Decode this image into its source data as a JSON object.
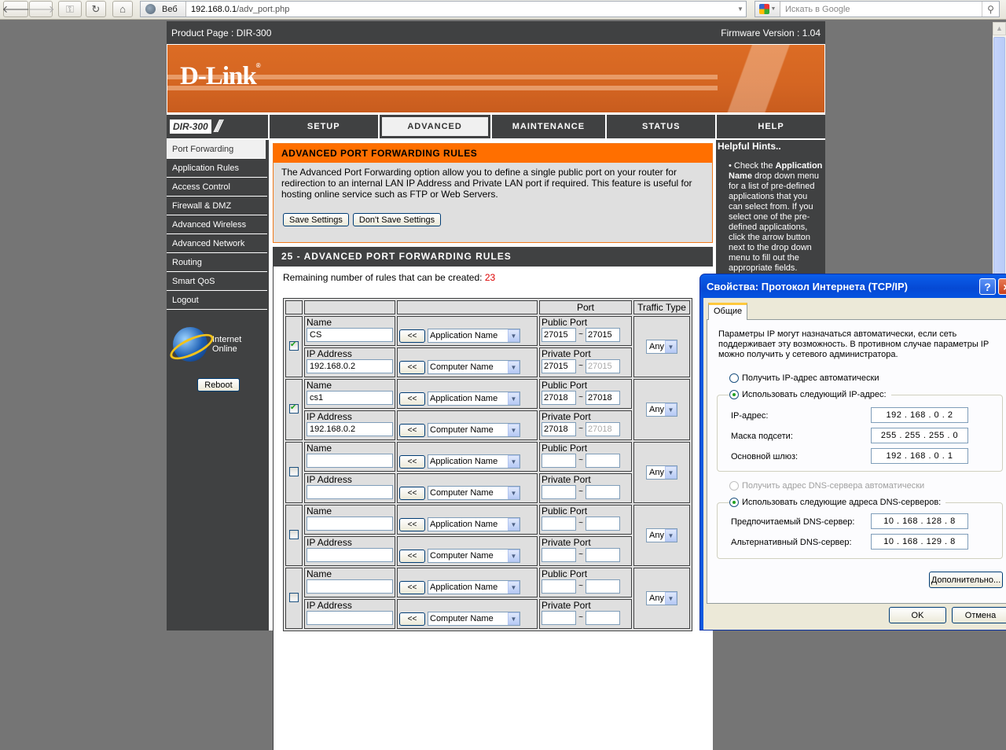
{
  "browser": {
    "url_host": "192.168.0.1",
    "url_path": "/adv_port.php",
    "web_chip": "Веб",
    "search_placeholder": "Искать в Google"
  },
  "router": {
    "product_page": "Product Page :  DIR-300",
    "firmware": "Firmware Version : 1.04",
    "logo": "D-Link",
    "model": "DIR-300",
    "tabs": [
      {
        "label": "SETUP",
        "active": false
      },
      {
        "label": "ADVANCED",
        "active": true
      },
      {
        "label": "MAINTENANCE",
        "active": false
      },
      {
        "label": "STATUS",
        "active": false
      },
      {
        "label": "HELP",
        "active": false
      }
    ],
    "sidebar": [
      {
        "label": "Port Forwarding",
        "active": true
      },
      {
        "label": "Application Rules"
      },
      {
        "label": "Access Control"
      },
      {
        "label": "Firewall & DMZ"
      },
      {
        "label": "Advanced Wireless"
      },
      {
        "label": "Advanced Network"
      },
      {
        "label": "Routing"
      },
      {
        "label": "Smart QoS"
      },
      {
        "label": "Logout"
      }
    ],
    "internet_status_line1": "Internet",
    "internet_status_line2": "Online",
    "reboot_label": "Reboot",
    "intro": {
      "title": "ADVANCED PORT FORWARDING RULES",
      "description": "The Advanced Port Forwarding option allow you to define a single public port on your router for redirection to an internal LAN IP Address and Private LAN port if required. This feature is useful for hosting online service such as FTP or Web Servers.",
      "save_label": "Save Settings",
      "dont_save_label": "Don't Save Settings"
    },
    "rules": {
      "title": "25 - ADVANCED PORT FORWARDING RULES",
      "remaining_label": "Remaining number of rules that can be created: ",
      "remaining_count": "23",
      "headers": {
        "port": "Port",
        "traffic": "Traffic Type"
      },
      "labels": {
        "name": "Name",
        "ip": "IP Address",
        "public_port": "Public Port",
        "private_port": "Private Port",
        "arrow": "<<",
        "app_select": "Application Name",
        "computer_select": "Computer Name",
        "tilde": "~"
      },
      "rows": [
        {
          "checked": true,
          "name": "CS",
          "ip": "192.168.0.2",
          "pub_start": "27015",
          "pub_end": "27015",
          "priv_start": "27015",
          "priv_end": "27015",
          "traffic": "Any"
        },
        {
          "checked": true,
          "name": "cs1",
          "ip": "192.168.0.2",
          "pub_start": "27018",
          "pub_end": "27018",
          "priv_start": "27018",
          "priv_end": "27018",
          "traffic": "Any"
        },
        {
          "checked": false,
          "name": "",
          "ip": "",
          "pub_start": "",
          "pub_end": "",
          "priv_start": "",
          "priv_end": "",
          "traffic": "Any"
        },
        {
          "checked": false,
          "name": "",
          "ip": "",
          "pub_start": "",
          "pub_end": "",
          "priv_start": "",
          "priv_end": "",
          "traffic": "Any"
        },
        {
          "checked": false,
          "name": "",
          "ip": "",
          "pub_start": "",
          "pub_end": "",
          "priv_start": "",
          "priv_end": "",
          "traffic": "Any"
        }
      ]
    },
    "help": {
      "title": "Helpful Hints..",
      "pre": "• Check the ",
      "bold1": "Application Name",
      "post": " drop down menu for a list of pre-defined applications that you can select from. If you select one of the pre-defined applications, click the arrow button next to the drop down menu to fill out the appropriate fields."
    }
  },
  "dialog": {
    "title": "Свойства: Протокол Интернета (TCP/IP)",
    "help_btn": "?",
    "close_btn": "×",
    "tab": "Общие",
    "description": "Параметры IP могут назначаться автоматически, если сеть поддерживает эту возможность. В противном случае параметры IP можно получить у сетевого администратора.",
    "auto_ip": "Получить IP-адрес автоматически",
    "manual_ip": "Использовать следующий IP-адрес:",
    "ip_label": "IP-адрес:",
    "ip_value": "192 . 168 .   0  .   2",
    "mask_label": "Маска подсети:",
    "mask_value": "255 . 255 . 255 .   0",
    "gw_label": "Основной шлюз:",
    "gw_value": "192 . 168 .   0  .   1",
    "auto_dns": "Получить адрес DNS-сервера автоматически",
    "manual_dns": "Использовать следующие адреса DNS-серверов:",
    "dns1_label": "Предпочитаемый DNS-сервер:",
    "dns1_value": "10  . 168 . 128 .   8",
    "dns2_label": "Альтернативный DNS-сервер:",
    "dns2_value": "10  . 168 . 129 .   8",
    "advanced_btn": "Дополнительно...",
    "ok_btn": "OK",
    "cancel_btn": "Отмена",
    "ip_mode": "manual",
    "dns_mode": "manual"
  }
}
